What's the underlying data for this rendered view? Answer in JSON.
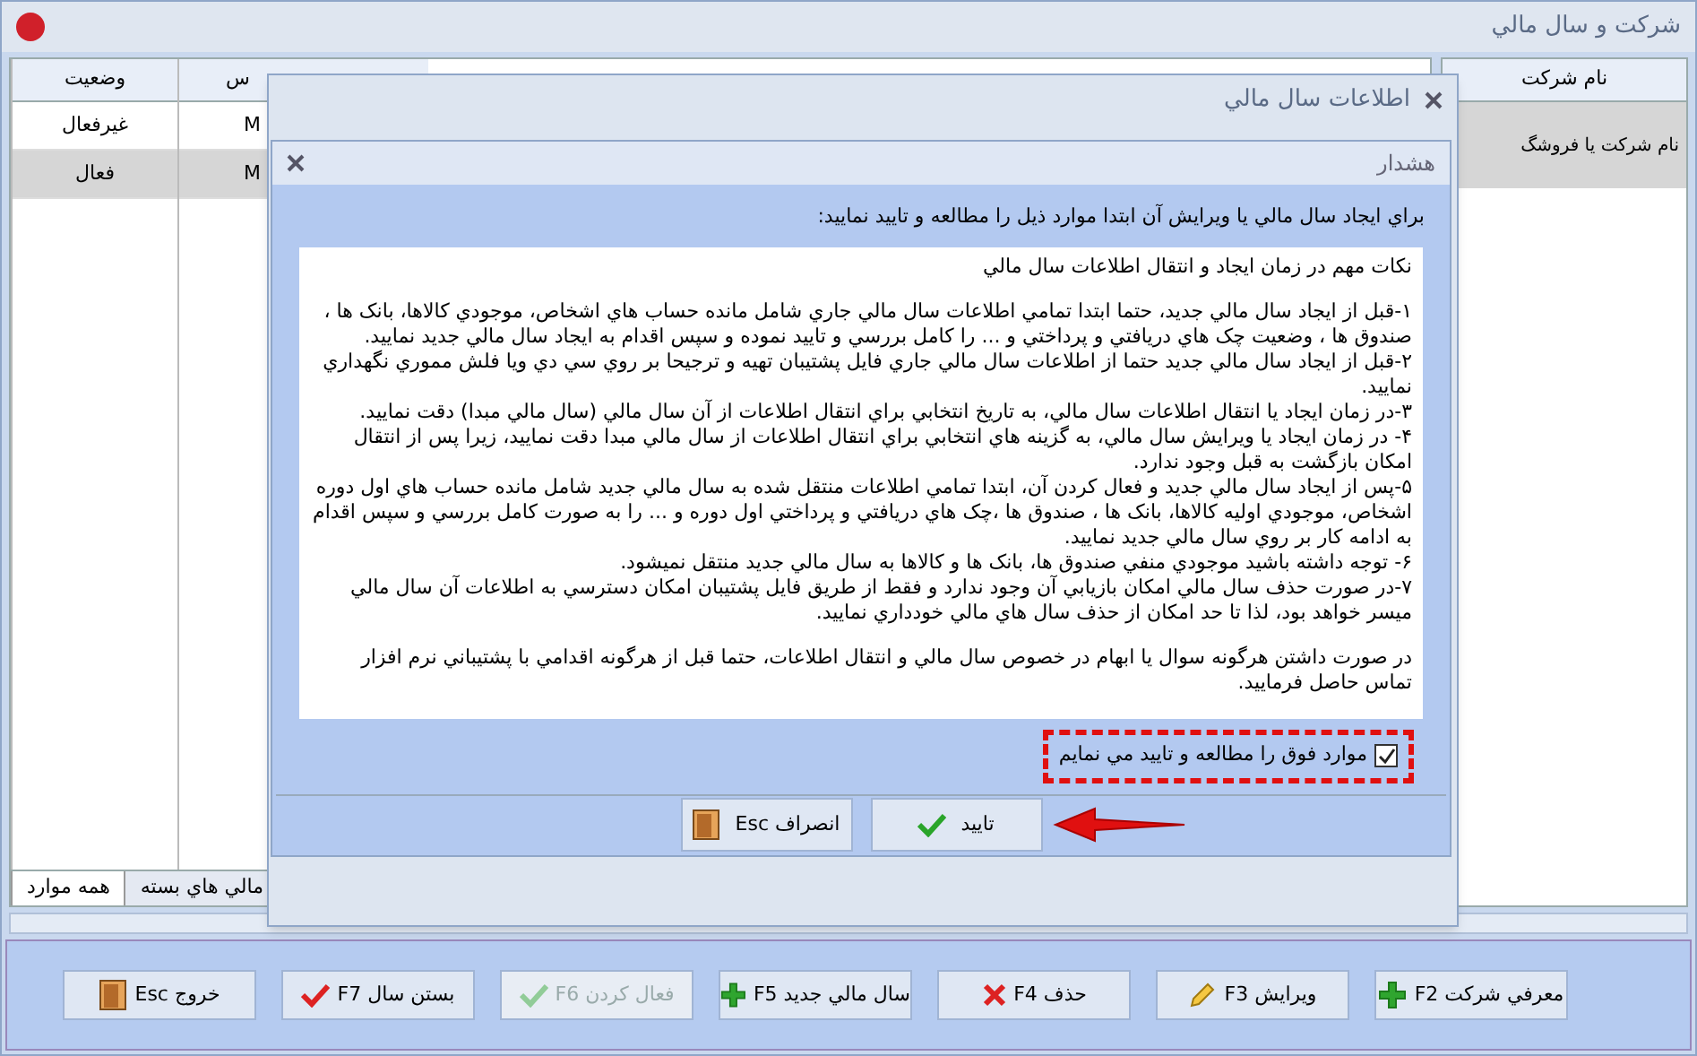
{
  "window": {
    "title": "شرکت و سال مالي"
  },
  "company_panel": {
    "header": "نام شرکت",
    "rows": [
      {
        "name": "نام شرکت يا فروشگ",
        "selected": true
      }
    ]
  },
  "years_table": {
    "columns": [
      "س",
      "وضعيت"
    ],
    "rows": [
      {
        "column_1": "M",
        "status": "غيرفعال",
        "selected": false
      },
      {
        "column_1": "M",
        "status": "فعال",
        "selected": true
      }
    ]
  },
  "bottom_tabs": [
    {
      "label": "مالي هاي بسته",
      "selected": false
    },
    {
      "label": "همه موارد",
      "selected": true
    }
  ],
  "year_dialog": {
    "title": "اطلاعات سال مالي"
  },
  "warning_dialog": {
    "title": "هشدار",
    "intro": "براي ايجاد سال مالي يا ويرايش آن ابتدا موارد ذيل را مطالعه و تاييد نماييد:",
    "notes": [
      {
        "kind": "heading",
        "text": "نکات مهم در زمان ايجاد و انتقال اطلاعات سال مالي"
      },
      {
        "kind": "item",
        "text": "۱-قبل از ايجاد سال مالي جديد، حتما ابتدا تمامي اطلاعات سال مالي جاري شامل مانده حساب هاي اشخاص، موجودي کالاها، بانک ها ، صندوق ها ، وضعيت چک هاي دريافتي و پرداختي و ... را کامل بررسي و تاييد نموده و سپس اقدام به ايجاد سال مالي جديد نماييد."
      },
      {
        "kind": "item",
        "text": "۲-قبل از ايجاد سال مالي جديد حتما از اطلاعات سال مالي جاري فايل پشتيبان تهيه و ترجيحا بر روي سي دي ويا فلش مموري نگهداري نماييد."
      },
      {
        "kind": "item",
        "text": "۳-در زمان ايجاد يا انتقال اطلاعات سال مالي، به تاريخ انتخابي براي انتقال اطلاعات از آن سال مالي (سال مالي مبدا) دقت نماييد."
      },
      {
        "kind": "item",
        "text": "۴- در زمان ايجاد يا ويرايش سال مالي، به گزينه هاي انتخابي براي انتقال اطلاعات از سال مالي مبدا دقت نماييد، زيرا پس از انتقال امکان بازگشت به قبل وجود ندارد."
      },
      {
        "kind": "item",
        "text": "۵-پس از ايجاد سال مالي جديد و فعال کردن آن، ابتدا تمامي اطلاعات منتقل شده به سال مالي جديد شامل مانده حساب هاي اول دوره اشخاص، موجودي اوليه کالاها، بانک ها ، صندوق ها ،چک هاي دريافتي و پرداختي اول دوره و ... را به صورت کامل بررسي و سپس اقدام به ادامه کار بر روي سال مالي جديد نماييد."
      },
      {
        "kind": "item",
        "text": "۶- توجه داشته باشيد موجودي منفي صندوق ها، بانک ها و کالاها به سال مالي جديد منتقل نميشود."
      },
      {
        "kind": "item",
        "text": "۷-در صورت حذف سال مالي امکان بازيابي آن وجود ندارد و فقط از طريق فايل پشتيبان امکان دسترسي به اطلاعات آن سال مالي ميسر خواهد بود، لذا تا حد امکان از حذف سال هاي مالي خودداري نماييد."
      },
      {
        "kind": "closing",
        "text": "در صورت داشتن هرگونه سوال يا ابهام در خصوص سال مالي و انتقال اطلاعات، حتما قبل از هرگونه اقدامي با پشتيباني نرم افزار تماس حاصل فرماييد."
      }
    ],
    "agree": {
      "label": "موارد فوق را مطالعه و تاييد مي نمايم",
      "checked": true
    },
    "buttons": [
      {
        "label": "تاييد"
      },
      {
        "label": "انصراف Esc"
      }
    ]
  },
  "toolbar": [
    {
      "label": "معرفي شرکت F2",
      "disabled": false
    },
    {
      "label": "ويرايش F3",
      "disabled": false
    },
    {
      "label": "حذف F4",
      "disabled": false
    },
    {
      "label": "سال مالي جديد F5",
      "disabled": false
    },
    {
      "label": "فعال کردن F6",
      "disabled": true
    },
    {
      "label": "بستن سال F7",
      "disabled": false
    },
    {
      "label": "خروج Esc",
      "disabled": false
    }
  ]
}
